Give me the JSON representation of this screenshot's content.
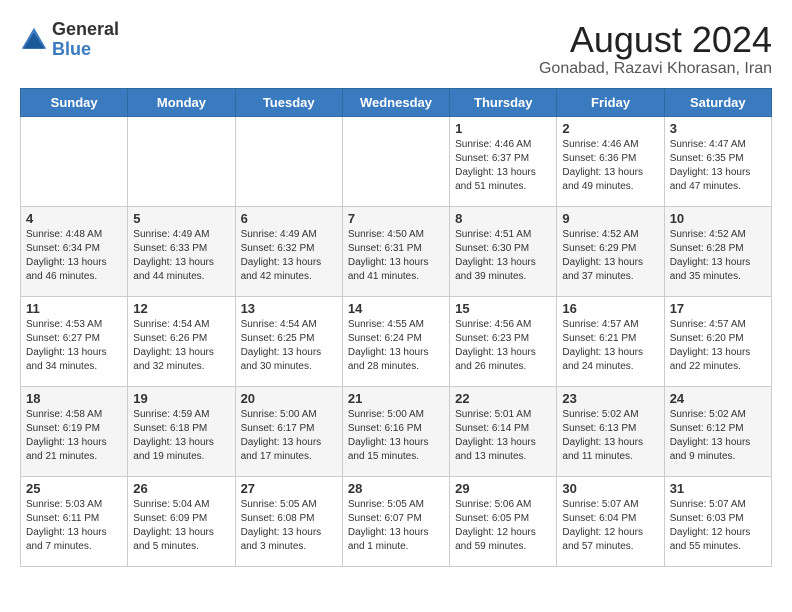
{
  "logo": {
    "general": "General",
    "blue": "Blue"
  },
  "title": "August 2024",
  "location": "Gonabad, Razavi Khorasan, Iran",
  "days_of_week": [
    "Sunday",
    "Monday",
    "Tuesday",
    "Wednesday",
    "Thursday",
    "Friday",
    "Saturday"
  ],
  "weeks": [
    [
      {
        "day": "",
        "content": ""
      },
      {
        "day": "",
        "content": ""
      },
      {
        "day": "",
        "content": ""
      },
      {
        "day": "",
        "content": ""
      },
      {
        "day": "1",
        "content": "Sunrise: 4:46 AM\nSunset: 6:37 PM\nDaylight: 13 hours\nand 51 minutes."
      },
      {
        "day": "2",
        "content": "Sunrise: 4:46 AM\nSunset: 6:36 PM\nDaylight: 13 hours\nand 49 minutes."
      },
      {
        "day": "3",
        "content": "Sunrise: 4:47 AM\nSunset: 6:35 PM\nDaylight: 13 hours\nand 47 minutes."
      }
    ],
    [
      {
        "day": "4",
        "content": "Sunrise: 4:48 AM\nSunset: 6:34 PM\nDaylight: 13 hours\nand 46 minutes."
      },
      {
        "day": "5",
        "content": "Sunrise: 4:49 AM\nSunset: 6:33 PM\nDaylight: 13 hours\nand 44 minutes."
      },
      {
        "day": "6",
        "content": "Sunrise: 4:49 AM\nSunset: 6:32 PM\nDaylight: 13 hours\nand 42 minutes."
      },
      {
        "day": "7",
        "content": "Sunrise: 4:50 AM\nSunset: 6:31 PM\nDaylight: 13 hours\nand 41 minutes."
      },
      {
        "day": "8",
        "content": "Sunrise: 4:51 AM\nSunset: 6:30 PM\nDaylight: 13 hours\nand 39 minutes."
      },
      {
        "day": "9",
        "content": "Sunrise: 4:52 AM\nSunset: 6:29 PM\nDaylight: 13 hours\nand 37 minutes."
      },
      {
        "day": "10",
        "content": "Sunrise: 4:52 AM\nSunset: 6:28 PM\nDaylight: 13 hours\nand 35 minutes."
      }
    ],
    [
      {
        "day": "11",
        "content": "Sunrise: 4:53 AM\nSunset: 6:27 PM\nDaylight: 13 hours\nand 34 minutes."
      },
      {
        "day": "12",
        "content": "Sunrise: 4:54 AM\nSunset: 6:26 PM\nDaylight: 13 hours\nand 32 minutes."
      },
      {
        "day": "13",
        "content": "Sunrise: 4:54 AM\nSunset: 6:25 PM\nDaylight: 13 hours\nand 30 minutes."
      },
      {
        "day": "14",
        "content": "Sunrise: 4:55 AM\nSunset: 6:24 PM\nDaylight: 13 hours\nand 28 minutes."
      },
      {
        "day": "15",
        "content": "Sunrise: 4:56 AM\nSunset: 6:23 PM\nDaylight: 13 hours\nand 26 minutes."
      },
      {
        "day": "16",
        "content": "Sunrise: 4:57 AM\nSunset: 6:21 PM\nDaylight: 13 hours\nand 24 minutes."
      },
      {
        "day": "17",
        "content": "Sunrise: 4:57 AM\nSunset: 6:20 PM\nDaylight: 13 hours\nand 22 minutes."
      }
    ],
    [
      {
        "day": "18",
        "content": "Sunrise: 4:58 AM\nSunset: 6:19 PM\nDaylight: 13 hours\nand 21 minutes."
      },
      {
        "day": "19",
        "content": "Sunrise: 4:59 AM\nSunset: 6:18 PM\nDaylight: 13 hours\nand 19 minutes."
      },
      {
        "day": "20",
        "content": "Sunrise: 5:00 AM\nSunset: 6:17 PM\nDaylight: 13 hours\nand 17 minutes."
      },
      {
        "day": "21",
        "content": "Sunrise: 5:00 AM\nSunset: 6:16 PM\nDaylight: 13 hours\nand 15 minutes."
      },
      {
        "day": "22",
        "content": "Sunrise: 5:01 AM\nSunset: 6:14 PM\nDaylight: 13 hours\nand 13 minutes."
      },
      {
        "day": "23",
        "content": "Sunrise: 5:02 AM\nSunset: 6:13 PM\nDaylight: 13 hours\nand 11 minutes."
      },
      {
        "day": "24",
        "content": "Sunrise: 5:02 AM\nSunset: 6:12 PM\nDaylight: 13 hours\nand 9 minutes."
      }
    ],
    [
      {
        "day": "25",
        "content": "Sunrise: 5:03 AM\nSunset: 6:11 PM\nDaylight: 13 hours\nand 7 minutes."
      },
      {
        "day": "26",
        "content": "Sunrise: 5:04 AM\nSunset: 6:09 PM\nDaylight: 13 hours\nand 5 minutes."
      },
      {
        "day": "27",
        "content": "Sunrise: 5:05 AM\nSunset: 6:08 PM\nDaylight: 13 hours\nand 3 minutes."
      },
      {
        "day": "28",
        "content": "Sunrise: 5:05 AM\nSunset: 6:07 PM\nDaylight: 13 hours\nand 1 minute."
      },
      {
        "day": "29",
        "content": "Sunrise: 5:06 AM\nSunset: 6:05 PM\nDaylight: 12 hours\nand 59 minutes."
      },
      {
        "day": "30",
        "content": "Sunrise: 5:07 AM\nSunset: 6:04 PM\nDaylight: 12 hours\nand 57 minutes."
      },
      {
        "day": "31",
        "content": "Sunrise: 5:07 AM\nSunset: 6:03 PM\nDaylight: 12 hours\nand 55 minutes."
      }
    ]
  ]
}
